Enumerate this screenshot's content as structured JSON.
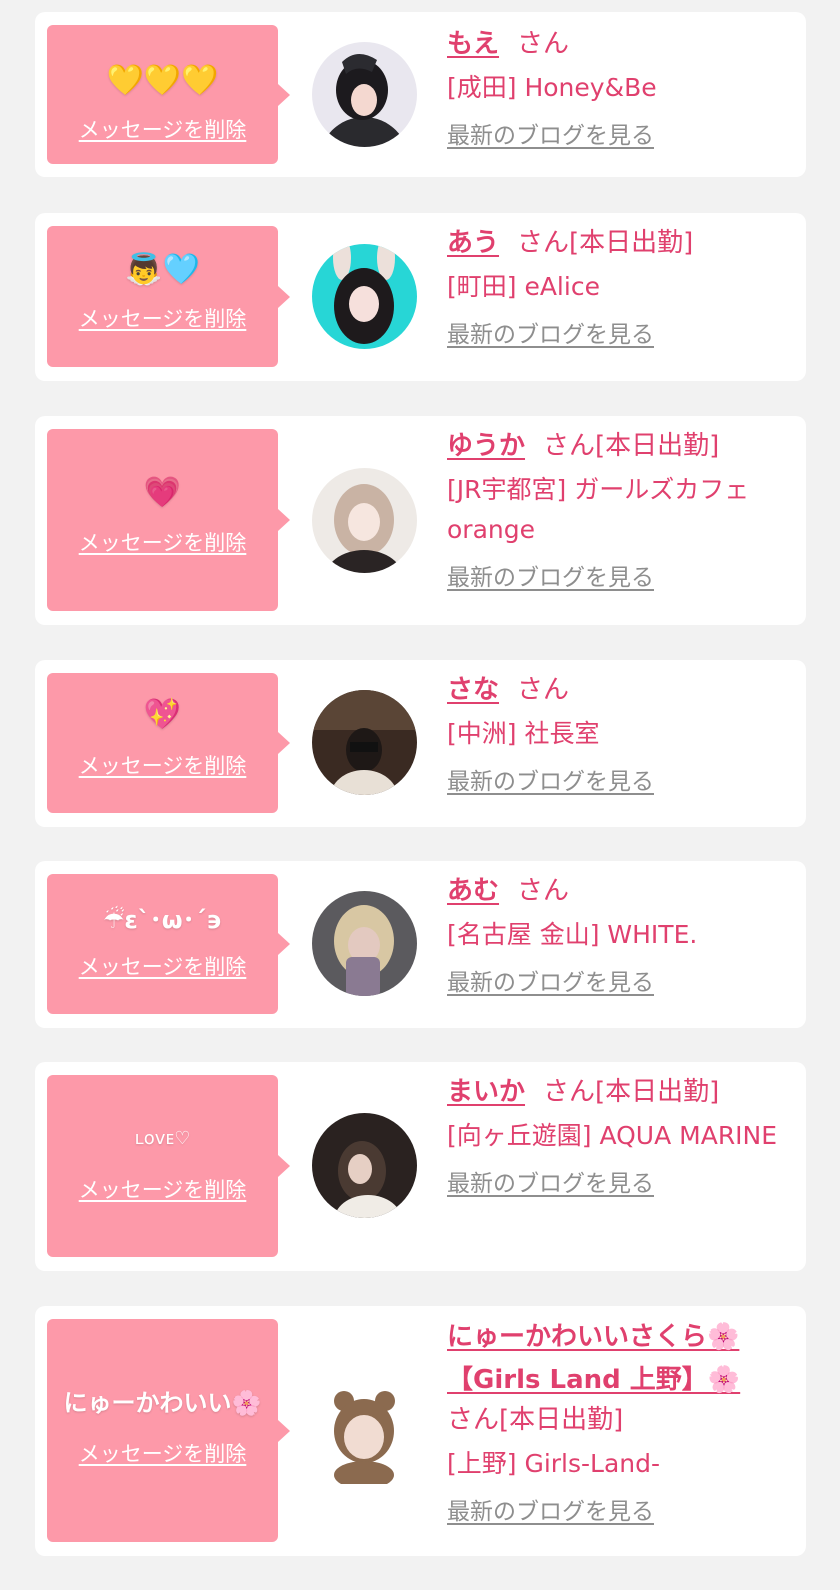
{
  "colors": {
    "page_bg": "#f2f2f2",
    "card_bg": "#ffffff",
    "message_box": "#fd99a9",
    "name_pink": "#e0406e",
    "link_gray": "#8e8e8e"
  },
  "delete_label": "メッセージを削除",
  "blog_label": "最新のブログを見る",
  "san_label": "さん",
  "entries": [
    {
      "message": "💛💛💛",
      "name": "もえ",
      "status": "",
      "shop": "[成田] Honey&Be"
    },
    {
      "message": "👼🩵",
      "name": "あう",
      "status": "[本日出勤]",
      "shop": "[町田] eAlice"
    },
    {
      "message": "💗",
      "name": "ゆうか",
      "status": "[本日出勤]",
      "shop": "[JR宇都宮] ガールズカフェorange"
    },
    {
      "message": "💖",
      "name": "さな",
      "status": "",
      "shop": "[中洲] 社長室"
    },
    {
      "message": "☔︎ε`･ω･´϶",
      "name": "あむ",
      "status": "",
      "shop": "[名古屋 金山] WHITE."
    },
    {
      "message": "ʟᴏᴠᴇ♡",
      "name": "まいか",
      "status": "[本日出勤]",
      "shop": "[向ヶ丘遊園] AQUA MARINE"
    },
    {
      "message": "にゅーかわいい🌸",
      "name": "にゅーかわいいさくら🌸【Girls Land 上野】🌸",
      "status": "[本日出勤]",
      "shop": "[上野] Girls-Land-"
    }
  ]
}
